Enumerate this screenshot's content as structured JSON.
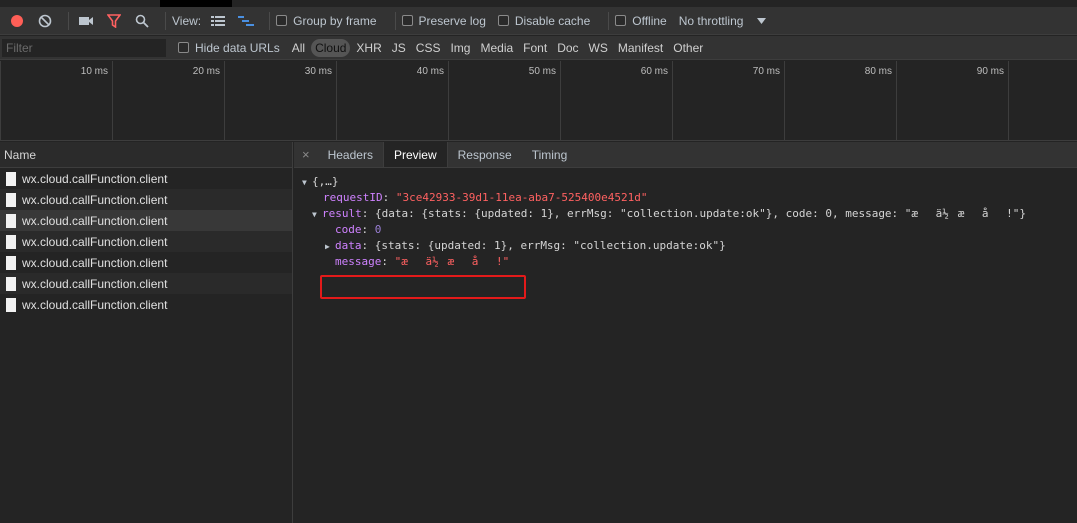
{
  "toolbar": {
    "view_label": "View:",
    "group_by_frame": "Group by frame",
    "preserve_log": "Preserve log",
    "disable_cache": "Disable cache",
    "offline": "Offline",
    "throttling": "No throttling",
    "record_color": "#ff5f57",
    "filter_color": "#ff6161",
    "waterfall_color": "#4a90e2"
  },
  "filter": {
    "placeholder": "Filter",
    "hide_data_urls": "Hide data URLs",
    "types": [
      "All",
      "Cloud",
      "XHR",
      "JS",
      "CSS",
      "Img",
      "Media",
      "Font",
      "Doc",
      "WS",
      "Manifest",
      "Other"
    ],
    "active_type": "Cloud"
  },
  "timeline": {
    "ticks": [
      "10 ms",
      "20 ms",
      "30 ms",
      "40 ms",
      "50 ms",
      "60 ms",
      "70 ms",
      "80 ms",
      "90 ms"
    ]
  },
  "requests": {
    "header": "Name",
    "items": [
      "wx.cloud.callFunction.client",
      "wx.cloud.callFunction.client",
      "wx.cloud.callFunction.client",
      "wx.cloud.callFunction.client",
      "wx.cloud.callFunction.client",
      "wx.cloud.callFunction.client",
      "wx.cloud.callFunction.client"
    ]
  },
  "tabs": {
    "close": "×",
    "headers": "Headers",
    "preview": "Preview",
    "response": "Response",
    "timing": "Timing"
  },
  "preview": {
    "root": "{,…}",
    "requestID_key": "requestID",
    "requestID_value": "\"3ce42933-39d1-11ea-aba7-525400e4521d\"",
    "result_key": "result",
    "result_summary": "{data: {stats: {updated: 1}, errMsg: \"collection.update:ok\"}, code: 0, message: \"æä½æå!\"}",
    "code_key": "code",
    "code_value": "0",
    "data_key": "data",
    "data_summary": "{stats: {updated: 1}, errMsg: \"collection.update:ok\"}",
    "message_key": "message",
    "message_value": "\"æä½æå!\""
  }
}
